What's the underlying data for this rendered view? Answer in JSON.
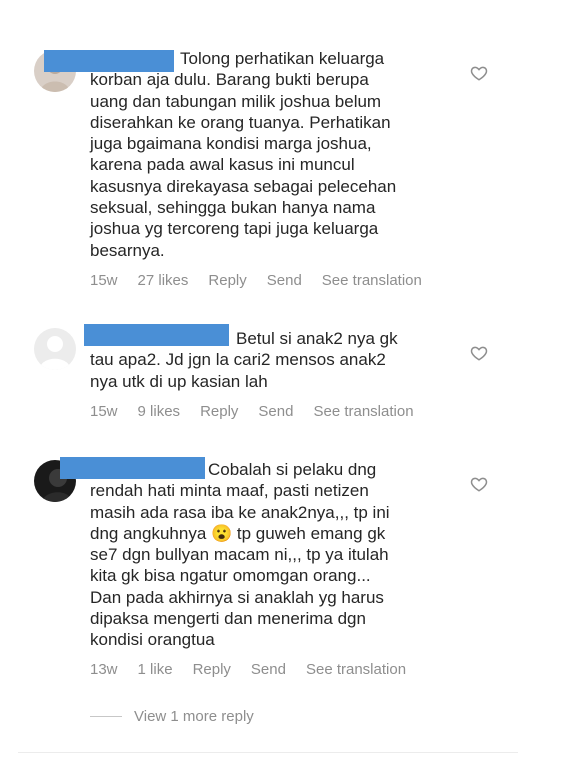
{
  "comments": [
    {
      "text": "Tolong perhatikan keluarga\nkorban aja dulu. Barang bukti berupa\nuang dan tabungan milik joshua belum\ndiserahkan ke orang tuanya. Perhatikan\njuga bgaimana kondisi marga joshua,\nkarena pada awal kasus ini muncul\nkasusnya direkayasa sebagai pelecehan\nseksual, sehingga bukan hanya nama\njoshua yg tercoreng tapi juga keluarga\nbesarnya.",
      "time": "15w",
      "likes": "27 likes",
      "reply": "Reply",
      "send": "Send",
      "translate": "See translation"
    },
    {
      "text": "Betul si anak2 nya gk\ntau apa2. Jd jgn la cari2 mensos anak2\nnya utk di up kasian lah",
      "time": "15w",
      "likes": "9 likes",
      "reply": "Reply",
      "send": "Send",
      "translate": "See translation"
    },
    {
      "text_a": "Cobalah si pelaku dng\nrendah hati minta maaf, pasti netizen\nmasih ada rasa iba ke anak2nya,,, tp ini\ndng angkuhnya ",
      "emoji": "😮",
      "text_b": " tp guweh emang gk\nse7 dgn bullyan macam ni,,, tp ya itulah\nkita gk bisa ngatur omomgan orang...\nDan pada akhirnya si anaklah yg harus\ndipaksa mengerti dan menerima dgn\nkondisi orangtua",
      "time": "13w",
      "likes": "1 like",
      "reply": "Reply",
      "send": "Send",
      "translate": "See translation"
    }
  ],
  "view_more": "View 1 more reply",
  "icons": {
    "heart": "heart-outline-icon",
    "avatar_placeholder": "default-avatar-icon"
  },
  "colors": {
    "redaction": "#4a8fd6",
    "meta": "#8e8e8e",
    "text": "#262626"
  }
}
